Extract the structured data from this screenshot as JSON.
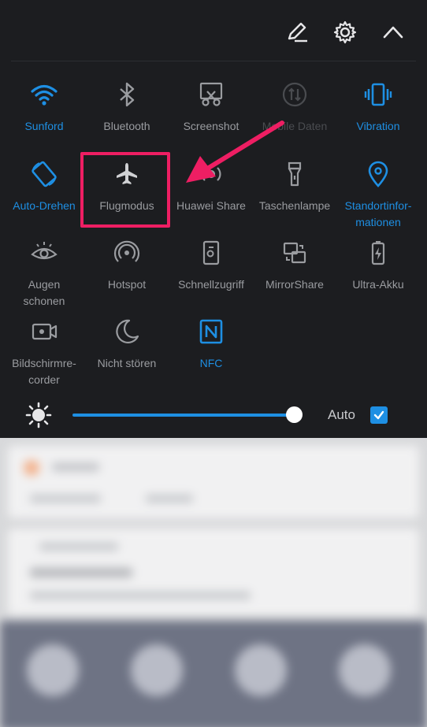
{
  "header": {
    "edit_icon": "pencil-icon",
    "settings_icon": "gear-icon",
    "collapse_icon": "chevron-up-icon"
  },
  "tiles": [
    {
      "label": "Sunford",
      "icon": "wifi-icon",
      "state": "active"
    },
    {
      "label": "Bluetooth",
      "icon": "bluetooth-icon",
      "state": "off"
    },
    {
      "label": "Screenshot",
      "icon": "scissors-icon",
      "state": "off"
    },
    {
      "label": "Mobile Daten",
      "icon": "mobile-data-icon",
      "state": "disabled"
    },
    {
      "label": "Vibration",
      "icon": "vibration-icon",
      "state": "active"
    },
    {
      "label": "Auto-Drehen",
      "icon": "rotate-icon",
      "state": "active"
    },
    {
      "label": "Flugmodus",
      "icon": "airplane-icon",
      "state": "off"
    },
    {
      "label": "Huawei Share",
      "icon": "share-icon",
      "state": "off"
    },
    {
      "label": "Taschenlampe",
      "icon": "flashlight-icon",
      "state": "off"
    },
    {
      "label": "Standortinfor-\nmationen",
      "icon": "location-icon",
      "state": "active"
    },
    {
      "label": "Augen\nschonen",
      "icon": "eye-icon",
      "state": "off"
    },
    {
      "label": "Hotspot",
      "icon": "hotspot-icon",
      "state": "off"
    },
    {
      "label": "Schnellzugriff",
      "icon": "quick-access-icon",
      "state": "off"
    },
    {
      "label": "MirrorShare",
      "icon": "mirror-share-icon",
      "state": "off"
    },
    {
      "label": "Ultra-Akku",
      "icon": "battery-icon",
      "state": "off"
    },
    {
      "label": "Bildschirmre-\ncorder",
      "icon": "screen-recorder-icon",
      "state": "off"
    },
    {
      "label": "Nicht stören",
      "icon": "moon-icon",
      "state": "off"
    },
    {
      "label": "NFC",
      "icon": "nfc-icon",
      "state": "active"
    }
  ],
  "brightness": {
    "level": 0.95,
    "auto_label": "Auto",
    "auto_checked": true
  },
  "colors": {
    "accent": "#1e8fe3",
    "highlight": "#ee1e63",
    "inactive": "#9a9ca0"
  }
}
